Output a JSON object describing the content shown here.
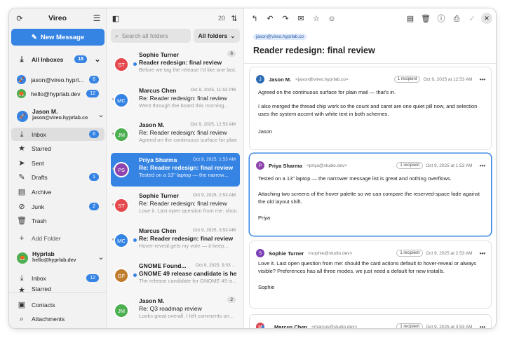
{
  "app": {
    "title": "Vireo",
    "new_message": "New Message"
  },
  "sidebar": {
    "all_inboxes": {
      "label": "All Inboxes",
      "count": "18"
    },
    "accounts": [
      {
        "label": "jason@vireo.hyprl...",
        "count": "6"
      },
      {
        "label": "hello@hyprlab.dev",
        "count": "12"
      }
    ],
    "account1": {
      "name": "Jason M.",
      "email": "jason@vireo.hyprlab.co"
    },
    "folders": [
      {
        "label": "Inbox",
        "count": "6"
      },
      {
        "label": "Starred"
      },
      {
        "label": "Sent"
      },
      {
        "label": "Drafts",
        "count": "1"
      },
      {
        "label": "Archive"
      },
      {
        "label": "Junk",
        "count": "2"
      },
      {
        "label": "Trash"
      }
    ],
    "add_folder": "Add Folder",
    "account2": {
      "name": "Hyprlab",
      "email": "hello@hyprlab.dev"
    },
    "folders2": [
      {
        "label": "Inbox",
        "count": "12"
      },
      {
        "label": "Starred"
      }
    ],
    "footer": [
      {
        "label": "Contacts"
      },
      {
        "label": "Attachments"
      }
    ]
  },
  "list": {
    "count": "20",
    "search_placeholder": "Search all folders",
    "filter": "All folders",
    "messages": [
      {
        "initials": "ST",
        "color": "#e5484d",
        "from": "Sophie Turner",
        "date": "Oct 9, 2025, 3:53 ...",
        "count": "6",
        "subject": "Reader redesign: final review",
        "preview": "Before we tag the release I'd like one last...",
        "bold": true
      },
      {
        "initials": "MC",
        "color": "#3584e4",
        "from": "Marcus Chen",
        "date": "Oct 8, 2025, 11:53 PM",
        "subject": "Re: Reader redesign: final review",
        "preview": "Went through the board this morning...",
        "bold": false
      },
      {
        "initials": "JM",
        "color": "#4caf50",
        "from": "Jason M.",
        "date": "Oct 9, 2025, 12:53 AM",
        "subject": "Re: Reader redesign: final review",
        "preview": "Agreed on the continuous surface for plain...",
        "bold": false
      },
      {
        "initials": "PS",
        "color": "#8e44ad",
        "from": "Priya Sharma",
        "date": "Oct 9, 2025, 1:53 AM",
        "subject": "Re: Reader redesign: final review",
        "preview": "Tested on a 13\" laptop — the narrow...",
        "bold": true
      },
      {
        "initials": "ST",
        "color": "#e5484d",
        "from": "Sophie Turner",
        "date": "Oct 9, 2025, 2:53 AM",
        "subject": "Re: Reader redesign: final review",
        "preview": "Love it. Last open question from me: should...",
        "bold": false
      },
      {
        "initials": "MC",
        "color": "#3584e4",
        "from": "Marcus Chen",
        "date": "Oct 9, 2025, 3:53 AM",
        "subject": "Re: Reader redesign: final review",
        "preview": "Hover-reveal gets my vote — it keep...",
        "bold": true
      },
      {
        "initials": "GF",
        "color": "#c17d2e",
        "from": "GNOME Found...",
        "date": "Oct 8, 2025, 9:53 ...",
        "subject": "GNOME 49 release candidate is here",
        "preview": "The release candidate for GNOME 49 is...",
        "bold": true
      },
      {
        "initials": "JM",
        "color": "#4caf50",
        "from": "Jason M.",
        "date": "Oct 8, 2025, 8:53 PM",
        "count": "2",
        "subject": "Re: Q3 roadmap review",
        "preview": "Looks great overall. I left comments on...",
        "bold": false
      }
    ]
  },
  "reader": {
    "account_tag": "jason@vireo.hyprlab.co",
    "subject": "Reader redesign: final review",
    "cards": [
      {
        "initial": "J",
        "color": "#2d6cb5",
        "name": "Jason M.",
        "email": "<jason@vireo.hyprlab.co>",
        "recipients": "1 recipient",
        "date": "Oct 9, 2025 at 12:53 AM",
        "body": [
          "Agreed on the continuous surface for plain mail — that's in.",
          "I also merged the thread chip work so the count and caret are one quiet pill now, and selection uses the system accent with white text in both schemes.",
          "Jason"
        ]
      },
      {
        "initial": "P",
        "color": "#8e44ad",
        "name": "Priya Sharma",
        "email": "<priya@studio.dev>",
        "recipients": "1 recipient",
        "date": "Oct 9, 2025 at 1:53 AM",
        "body": [
          "Tested on a 13\" laptop — the narrower message list is great and nothing overflows.",
          "Attaching two screens of the hover palette so we can compare the reserved-space fade against the old layout shift.",
          "Priya"
        ]
      },
      {
        "initial": "S",
        "color": "#7b3fb5",
        "name": "Sophie Turner",
        "email": "<sophie@studio.dev>",
        "recipients": "1 recipient",
        "date": "Oct 9, 2025 at 2:53 AM",
        "body": [
          "Love it. Last open question from me: should the card actions default to hover-reveal or always visible? Preferences has all three modes, we just need a default for new installs.",
          "Sophie"
        ]
      },
      {
        "initial": "M",
        "color": "#d9434f",
        "name": "Marcus Chen",
        "email": "<marcus@studio.dev>",
        "recipients": "1 recipient",
        "date": "Oct 9, 2025 at 3:53 AM",
        "body": []
      }
    ]
  }
}
